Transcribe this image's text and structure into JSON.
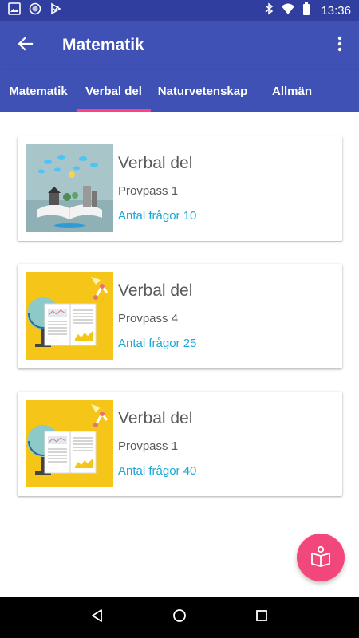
{
  "status_bar": {
    "time": "13:36",
    "left_icons": [
      "image-icon",
      "circle-icon",
      "download-check-icon"
    ],
    "right_icons": [
      "bluetooth-icon",
      "wifi-icon",
      "battery-icon"
    ]
  },
  "app_bar": {
    "title": "Matematik",
    "back_icon": "arrow-back-icon",
    "overflow_icon": "more-vert-icon"
  },
  "tabs": [
    {
      "label": "Matematik",
      "selected": false
    },
    {
      "label": "Verbal del",
      "selected": true
    },
    {
      "label": "Naturvetenskap",
      "selected": false
    },
    {
      "label": "Allmän",
      "selected": false
    }
  ],
  "cards": [
    {
      "title": "Verbal del",
      "subtitle": "Provpass 1",
      "count": "Antal frågor 10",
      "image": "book-landscape-illustration"
    },
    {
      "title": "Verbal del",
      "subtitle": "Provpass 4",
      "count": "Antal frågor 25",
      "image": "globe-book-illustration"
    },
    {
      "title": "Verbal del",
      "subtitle": "Provpass 1",
      "count": "Antal frågor 40",
      "image": "globe-book-illustration"
    }
  ],
  "fab": {
    "icon": "open-book-icon"
  },
  "nav": {
    "icons": [
      "back-triangle-icon",
      "home-circle-icon",
      "recents-square-icon"
    ]
  },
  "colors": {
    "primary": "#3F51B5",
    "primary_dark": "#303F9F",
    "accent": "#FF4081",
    "fab": "#F2477B",
    "count_text": "#1BA7D6"
  }
}
